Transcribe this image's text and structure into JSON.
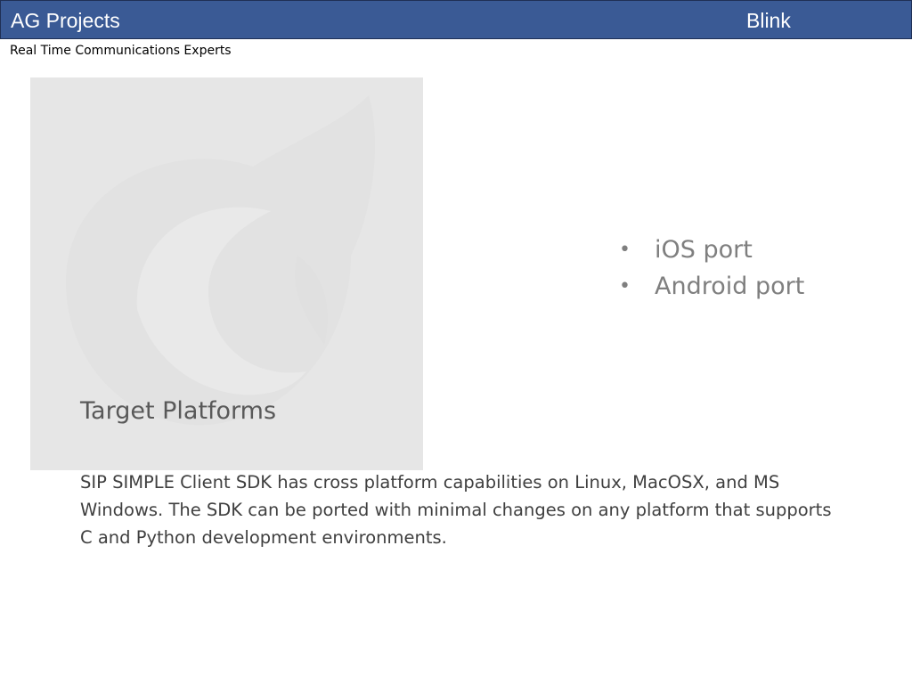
{
  "header": {
    "title": "AG Projects",
    "product": "Blink",
    "background_color": "#3a5a95"
  },
  "subtitle": "Real Time Communications Experts",
  "watermark": {
    "icon": "blink-logo-icon",
    "background_color": "#e6e6e6"
  },
  "bullets": [
    {
      "text": "iOS port"
    },
    {
      "text": "Android port"
    }
  ],
  "section": {
    "title": "Target Platforms",
    "body": "SIP SIMPLE Client SDK has cross platform capabilities on Linux, MacOSX,  and MS Windows. The SDK can be ported with minimal changes on any platform that supports C and Python development environments."
  }
}
